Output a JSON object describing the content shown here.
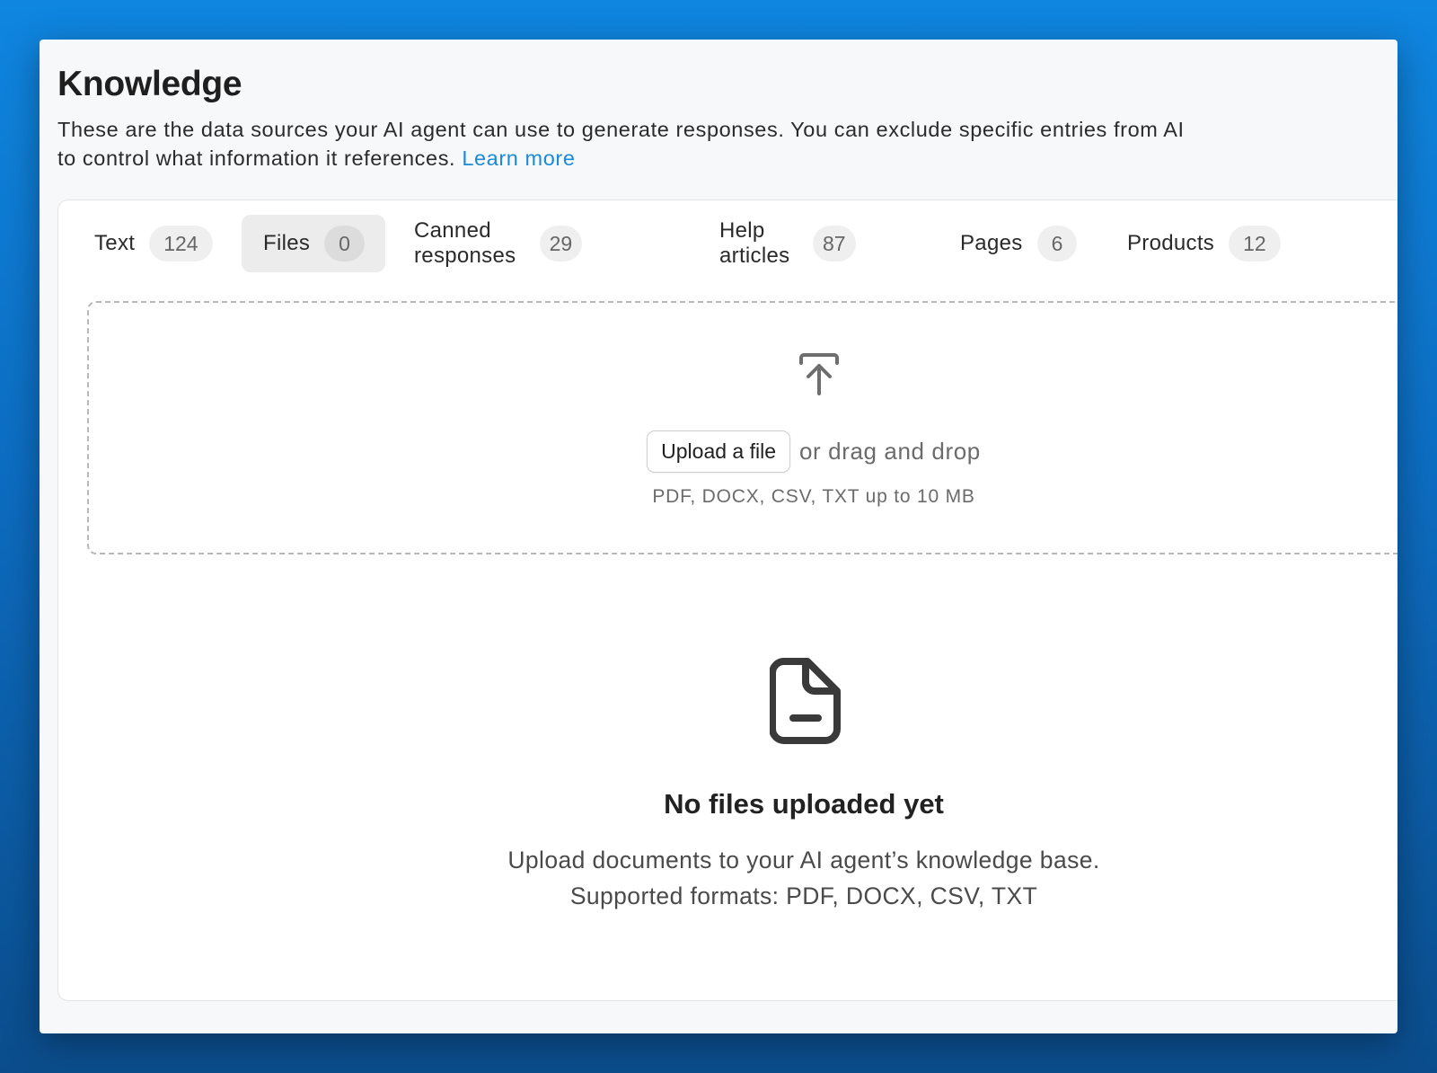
{
  "page": {
    "title": "Knowledge",
    "description": "These are the data sources your AI agent can use to generate responses. You can exclude specific entries from AI to control what information it references.",
    "learn_more": "Learn more"
  },
  "tabs": [
    {
      "label": "Text",
      "count": "124",
      "active": false
    },
    {
      "label": "Files",
      "count": "0",
      "active": true
    },
    {
      "label": "Canned responses",
      "count": "29",
      "active": false
    },
    {
      "label": "Help articles",
      "count": "87",
      "active": false
    },
    {
      "label": "Pages",
      "count": "6",
      "active": false
    },
    {
      "label": "Products",
      "count": "12",
      "active": false
    }
  ],
  "dropzone": {
    "icon": "upload-icon",
    "upload_button": "Upload a file",
    "or_text": "or drag and drop",
    "hint": "PDF, DOCX, CSV, TXT up to 10 MB"
  },
  "empty_state": {
    "icon": "file-icon",
    "title": "No files uploaded yet",
    "line1": "Upload documents to your AI agent’s knowledge base.",
    "line2": "Supported formats: PDF, DOCX, CSV, TXT"
  },
  "colors": {
    "background_top": "#0f86e0",
    "background_bottom": "#0b4d8c",
    "link": "#1b8ad9",
    "active_tab": "#ececec"
  }
}
